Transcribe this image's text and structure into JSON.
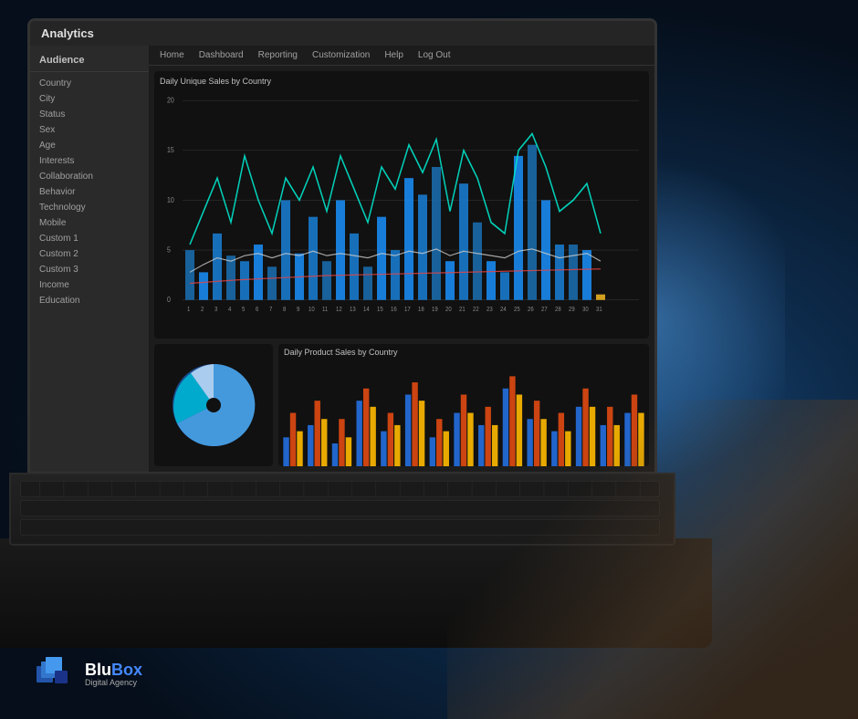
{
  "app": {
    "title": "Analytics",
    "background_color": "#0a1628"
  },
  "nav": {
    "items": [
      "Home",
      "Dashboard",
      "Reporting",
      "Customization",
      "Help",
      "Log Out"
    ]
  },
  "sidebar": {
    "header": "Audience",
    "items": [
      "Country",
      "City",
      "Status",
      "Sex",
      "Age",
      "Interests",
      "Collaboration",
      "Behavior",
      "Technology",
      "Mobile",
      "Custom 1",
      "Custom 2",
      "Custom 3",
      "Income",
      "Education"
    ]
  },
  "charts": {
    "top_title": "Daily Unique Sales by Country",
    "bottom_title": "Daily Product Sales by Country",
    "y_axis_labels": [
      "20",
      "15",
      "10",
      "5",
      "0"
    ],
    "x_axis_labels": [
      "1",
      "2",
      "3",
      "4",
      "5",
      "6",
      "7",
      "8",
      "9",
      "10",
      "11",
      "12",
      "13",
      "14",
      "15",
      "16",
      "17",
      "18",
      "19",
      "20",
      "21",
      "22",
      "23",
      "24",
      "25",
      "26",
      "27",
      "28",
      "29",
      "30",
      "31"
    ]
  },
  "logo": {
    "name": "BluBox",
    "name_part1": "Blu",
    "name_part2": "Box",
    "subtitle": "Digital Agency"
  }
}
